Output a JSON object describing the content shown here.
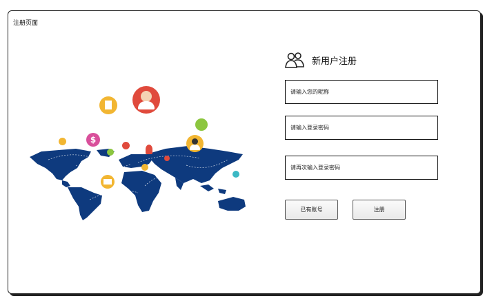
{
  "window": {
    "title": "注册页面"
  },
  "form": {
    "heading": "新用户注册",
    "heading_icon": "users-icon",
    "nickname_placeholder": "请输入您的昵称",
    "password_placeholder": "请输入登录密码",
    "confirm_placeholder": "请再次输入登录密码",
    "have_account_label": "已有账号",
    "register_label": "注册"
  },
  "illustration": {
    "description_icon": "world-map-icon",
    "map_color": "#0e3a7e",
    "bubble_icons": [
      "avatar-icon",
      "document-icon",
      "dollar-icon",
      "lightbulb-icon",
      "user-icon",
      "chat-icon",
      "mail-icon",
      "card-icon"
    ]
  }
}
